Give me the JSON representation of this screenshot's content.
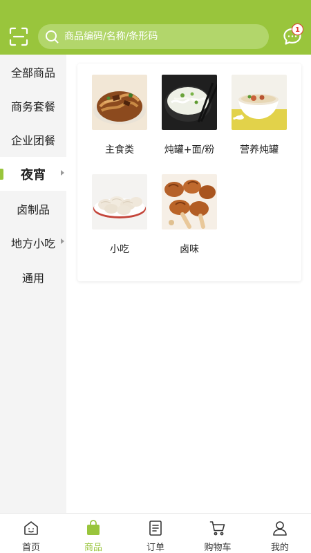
{
  "colors": {
    "brand": "#99c53c",
    "search_bg": "#b2d66b",
    "badge": "#e03a2e"
  },
  "header": {
    "search_placeholder": "商品编码/名称/条形码",
    "message_badge": "1"
  },
  "sidebar": {
    "items": [
      {
        "label": "全部商品",
        "active": false,
        "has_caret": false
      },
      {
        "label": "商务套餐",
        "active": false,
        "has_caret": false
      },
      {
        "label": "企业团餐",
        "active": false,
        "has_caret": false
      },
      {
        "label": "夜宵",
        "active": true,
        "has_caret": true
      },
      {
        "label": "卤制品",
        "active": false,
        "has_caret": false
      },
      {
        "label": "地方小吃",
        "active": false,
        "has_caret": true
      },
      {
        "label": "通用",
        "active": false,
        "has_caret": false
      }
    ]
  },
  "categories": [
    {
      "label": "主食类",
      "image": "fried-noodles-photo"
    },
    {
      "label": "炖罐+面/粉",
      "image": "noodle-soup-photo"
    },
    {
      "label": "营养炖罐",
      "image": "stew-bowl-photo"
    },
    {
      "label": "小吃",
      "image": "dumplings-photo"
    },
    {
      "label": "卤味",
      "image": "braised-duck-photo"
    }
  ],
  "bottom_nav": {
    "items": [
      {
        "label": "首页",
        "icon": "home-icon",
        "active": false
      },
      {
        "label": "商品",
        "icon": "bag-icon",
        "active": true
      },
      {
        "label": "订单",
        "icon": "order-icon",
        "active": false
      },
      {
        "label": "购物车",
        "icon": "cart-icon",
        "active": false
      },
      {
        "label": "我的",
        "icon": "profile-icon",
        "active": false
      }
    ]
  }
}
